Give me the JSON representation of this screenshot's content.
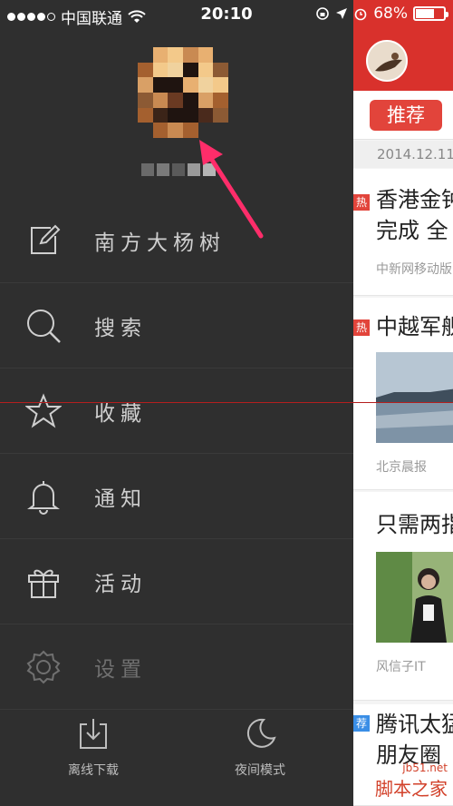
{
  "status_bar": {
    "carrier": "中国联通",
    "time": "20:10",
    "battery": "68%",
    "battery_level": 0.68
  },
  "drawer": {
    "menu": [
      {
        "label": "南方大杨树",
        "icon": "edit-icon",
        "dim": false
      },
      {
        "label": "搜索",
        "icon": "search-icon",
        "dim": false
      },
      {
        "label": "收藏",
        "icon": "star-icon",
        "dim": false
      },
      {
        "label": "通知",
        "icon": "bell-icon",
        "dim": false
      },
      {
        "label": "活动",
        "icon": "gift-icon",
        "dim": false
      },
      {
        "label": "设置",
        "icon": "gear-icon",
        "dim": true
      }
    ],
    "footer": {
      "offline_label": "离线下载",
      "night_label": "夜间模式"
    }
  },
  "news": {
    "tab": "推荐",
    "date": "2014.12.11",
    "cards": [
      {
        "badge": "热",
        "title_line1": "香港金钟",
        "title_line2": "完成 全",
        "source": "中新网移动版"
      },
      {
        "badge": "热",
        "title_line1": "中越军舰",
        "source": "北京晨报"
      },
      {
        "badge": "",
        "title_line1": "只需两指",
        "source": "风信子IT"
      },
      {
        "badge": "荐",
        "title_line1": "腾讯太猛",
        "title_line2": "朋友圈"
      }
    ]
  },
  "watermark": {
    "site": "jb51.net",
    "name": "脚本之家"
  }
}
